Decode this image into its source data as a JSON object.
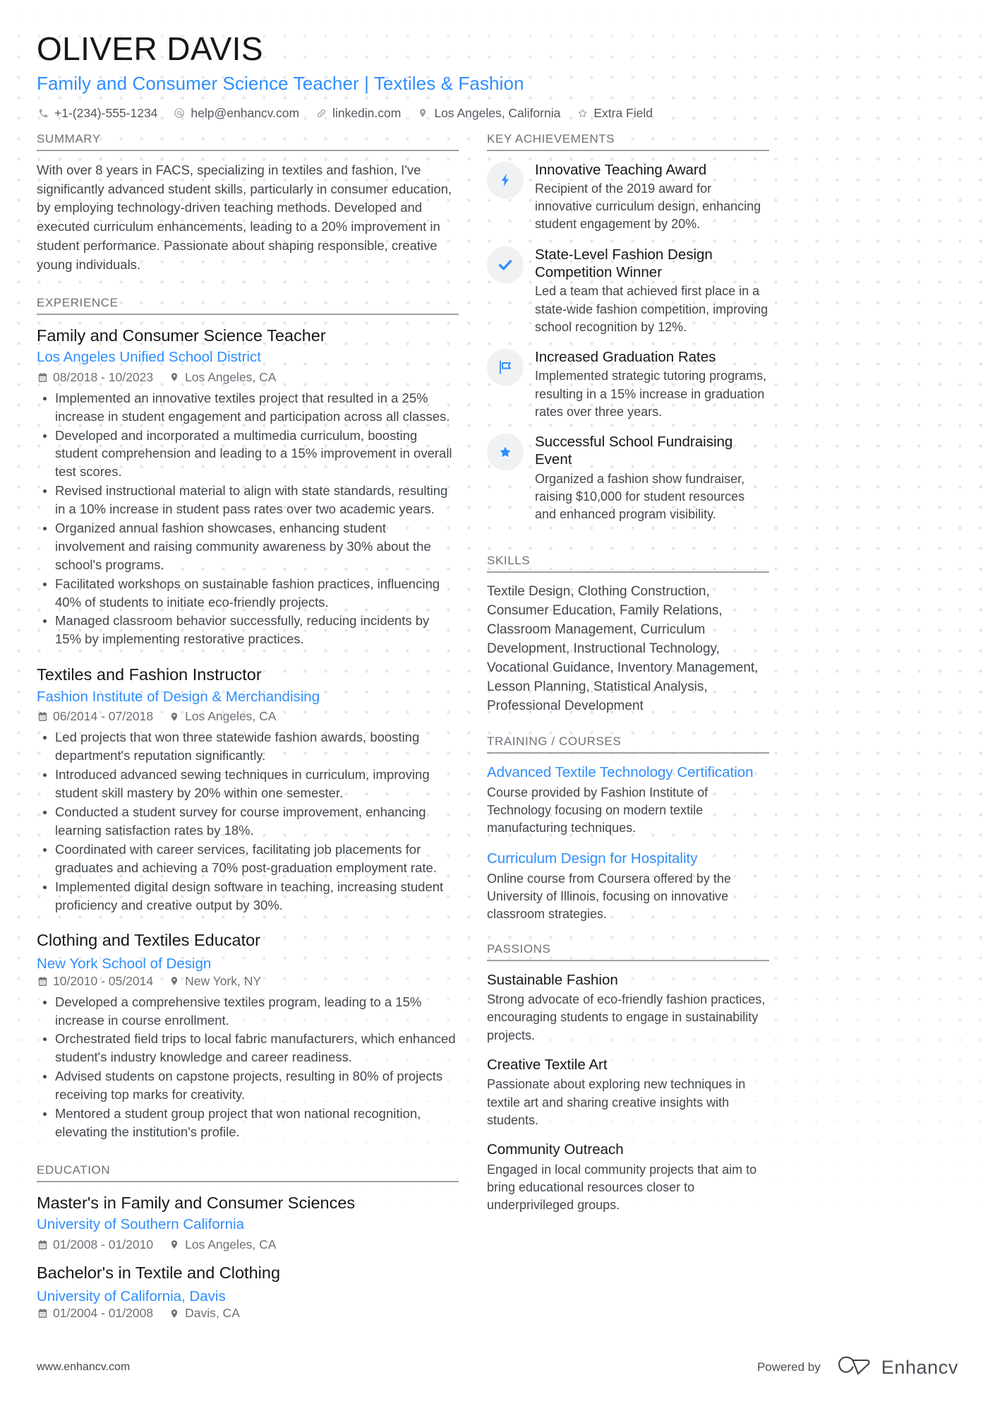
{
  "header": {
    "name": "OLIVER DAVIS",
    "title": "Family and Consumer Science Teacher | Textiles & Fashion",
    "contacts": [
      {
        "icon": "phone-icon",
        "text": "+1-(234)-555-1234"
      },
      {
        "icon": "email-icon",
        "text": "help@enhancv.com"
      },
      {
        "icon": "link-icon",
        "text": "linkedin.com"
      },
      {
        "icon": "location-pin-icon",
        "text": "Los Angeles, California"
      },
      {
        "icon": "star-outline-icon",
        "text": "Extra Field"
      }
    ]
  },
  "left": {
    "summary": {
      "heading": "SUMMARY",
      "text": "With over 8 years in FACS, specializing in textiles and fashion, I've significantly advanced student skills, particularly in consumer education, by employing technology-driven teaching methods. Developed and executed curriculum enhancements, leading to a 20% improvement in student performance. Passionate about shaping responsible, creative young individuals."
    },
    "experience": {
      "heading": "EXPERIENCE",
      "jobs": [
        {
          "role": "Family and Consumer Science Teacher",
          "company": "Los Angeles Unified School District",
          "dates": "08/2018 - 10/2023",
          "location": "Los Angeles, CA",
          "inline": false,
          "bullets": [
            "Implemented an innovative textiles project that resulted in a 25% increase in student engagement and participation across all classes.",
            "Developed and incorporated a multimedia curriculum, boosting student comprehension and leading to a 15% improvement in overall test scores.",
            "Revised instructional material to align with state standards, resulting in a 10% increase in student pass rates over two academic years.",
            "Organized annual fashion showcases, enhancing student involvement and raising community awareness by 30% about the school's programs.",
            "Facilitated workshops on sustainable fashion practices, influencing 40% of students to initiate eco-friendly projects.",
            "Managed classroom behavior successfully, reducing incidents by 15% by implementing restorative practices."
          ]
        },
        {
          "role": "Textiles and Fashion Instructor",
          "company": "Fashion Institute of Design & Merchandising",
          "dates": "06/2014 - 07/2018",
          "location": "Los Angeles, CA",
          "inline": false,
          "bullets": [
            "Led projects that won three statewide fashion awards, boosting department's reputation significantly.",
            "Introduced advanced sewing techniques in curriculum, improving student skill mastery by 20% within one semester.",
            "Conducted a student survey for course improvement, enhancing learning satisfaction rates by 18%.",
            "Coordinated with career services, facilitating job placements for graduates and achieving a 70% post-graduation employment rate.",
            "Implemented digital design software in teaching, increasing student proficiency and creative output by 30%."
          ]
        },
        {
          "role": "Clothing and Textiles Educator",
          "company": "New York School of Design",
          "dates": "10/2010 - 05/2014",
          "location": "New York, NY",
          "inline": true,
          "bullets": [
            "Developed a comprehensive textiles program, leading to a 15% increase in course enrollment.",
            "Orchestrated field trips to local fabric manufacturers, which enhanced student's industry knowledge and career readiness.",
            "Advised students on capstone projects, resulting in 80% of projects receiving top marks for creativity.",
            "Mentored a student group project that won national recognition, elevating the institution's profile."
          ]
        }
      ]
    },
    "education": {
      "heading": "EDUCATION",
      "entries": [
        {
          "degree": "Master's in Family and Consumer Sciences",
          "school": "University of Southern California",
          "dates": "01/2008 - 01/2010",
          "location": "Los Angeles, CA",
          "inline": false
        },
        {
          "degree": "Bachelor's in Textile and Clothing",
          "school": "University of California, Davis",
          "dates": "01/2004 - 01/2008",
          "location": "Davis, CA",
          "inline": true
        }
      ]
    }
  },
  "right": {
    "achievements": {
      "heading": "KEY ACHIEVEMENTS",
      "items": [
        {
          "icon": "lightning-bolt-icon",
          "title": "Innovative Teaching Award",
          "desc": "Recipient of the 2019 award for innovative curriculum design, enhancing student engagement by 20%."
        },
        {
          "icon": "check-icon",
          "title": "State-Level Fashion Design Competition Winner",
          "desc": "Led a team that achieved first place in a state-wide fashion competition, improving school recognition by 12%."
        },
        {
          "icon": "flag-icon",
          "title": "Increased Graduation Rates",
          "desc": "Implemented strategic tutoring programs, resulting in a 15% increase in graduation rates over three years."
        },
        {
          "icon": "star-icon",
          "title": "Successful School Fundraising Event",
          "desc": "Organized a fashion show fundraiser, raising $10,000 for student resources and enhanced program visibility."
        }
      ]
    },
    "skills": {
      "heading": "SKILLS",
      "text": "Textile Design, Clothing Construction, Consumer Education, Family Relations, Classroom Management, Curriculum Development, Instructional Technology, Vocational Guidance, Inventory Management, Lesson Planning, Statistical Analysis, Professional Development"
    },
    "training": {
      "heading": "TRAINING / COURSES",
      "items": [
        {
          "title": "Advanced Textile Technology Certification",
          "desc": "Course provided by Fashion Institute of Technology focusing on modern textile manufacturing techniques."
        },
        {
          "title": "Curriculum Design for Hospitality",
          "desc": "Online course from Coursera offered by the University of Illinois, focusing on innovative classroom strategies."
        }
      ]
    },
    "passions": {
      "heading": "PASSIONS",
      "items": [
        {
          "title": "Sustainable Fashion",
          "desc": "Strong advocate of eco-friendly fashion practices, encouraging students to engage in sustainability projects."
        },
        {
          "title": "Creative Textile Art",
          "desc": "Passionate about exploring new techniques in textile art and sharing creative insights with students."
        },
        {
          "title": "Community Outreach",
          "desc": "Engaged in local community projects that aim to bring educational resources closer to underprivileged groups."
        }
      ]
    }
  },
  "footer": {
    "url": "www.enhancv.com",
    "powered_label": "Powered by",
    "brand": "Enhancv"
  },
  "colors": {
    "accent": "#2f8efc",
    "heading": "#6d7277",
    "body": "#43484d",
    "name": "#15171a",
    "icon_bg": "#f0f1f2"
  }
}
